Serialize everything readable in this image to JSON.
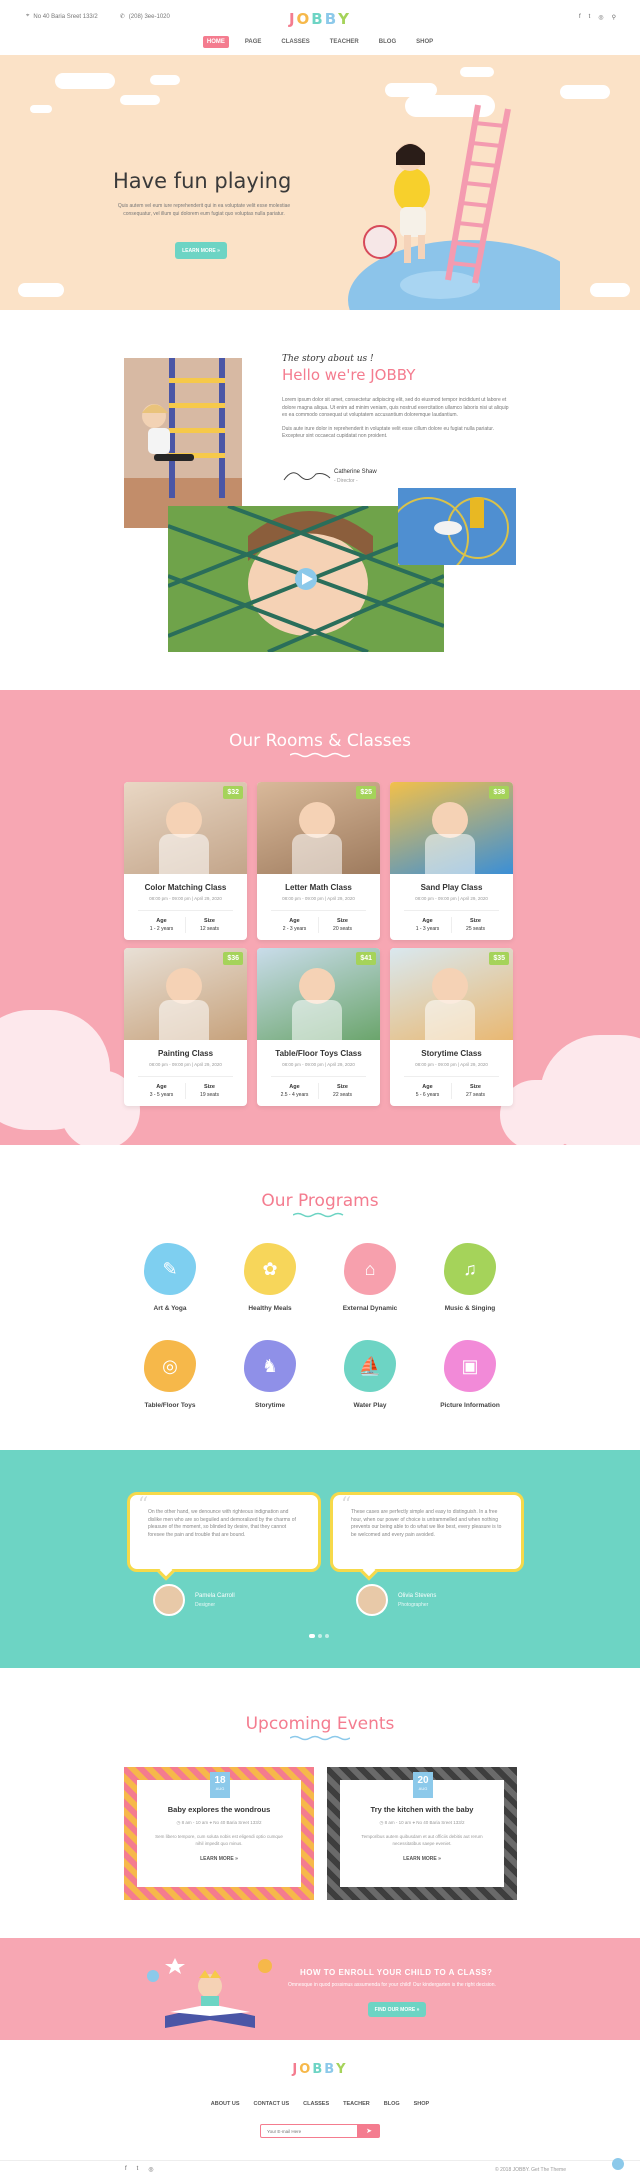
{
  "topbar": {
    "address": "No 40 Baria Sreet 133/2",
    "phone": "(208) 3ee-1020",
    "social": [
      "f",
      "t",
      "◎",
      "⚲"
    ]
  },
  "logo": {
    "letters": [
      "J",
      "O",
      "B",
      "B",
      "Y"
    ],
    "colors": [
      "#f47c8f",
      "#f6b84a",
      "#6dd4c4",
      "#8cc9ea",
      "#a5d35a"
    ]
  },
  "nav": [
    "HOME",
    "PAGE",
    "CLASSES",
    "TEACHER",
    "BLOG",
    "SHOP"
  ],
  "hero": {
    "title": "Have fun playing",
    "text": "Quis autem vel eum iure reprehenderit qui in ea voluptate velit esse molestiae consequatur, vel illum qui dolorem eum fugiat quo voluptas nulla pariatur.",
    "button": "LEARN MORE »"
  },
  "about": {
    "tagline": "The story about us !",
    "title": "Hello we're JOBBY",
    "para1": "Lorem ipsum dolor sit amet, consectetur adipiscing elit, sed do eiusmod tempor incididunt ut labore et dolore magna aliqua. Ut enim ad minim veniam, quis nostrud exercitation ullamco laboris nisi ut aliquip ex ea commodo consequat ut voluptatem accusantium doloremque laudantium.",
    "para2": "Duis aute irure dolor in reprehenderit in voluptate velit esse cillum dolore eu fugiat nulla pariatur. Excepteur sint occaecat cupidatat non proident.",
    "person_name": "Catherine Shaw",
    "person_role": "- Director -"
  },
  "rooms": {
    "title": "Our Rooms & Classes",
    "age_label": "Age",
    "size_label": "Size",
    "classes": [
      {
        "name": "Color Matching Class",
        "time": "08:00 pm - 09:00 pm",
        "date": "April 29, 2020",
        "price": "$32",
        "age": "1 - 2 years",
        "size": "12 seats",
        "c1": "#e9d7c4",
        "c2": "#c3a58a"
      },
      {
        "name": "Letter Math Class",
        "time": "08:00 pm - 09:00 pm",
        "date": "April 29, 2020",
        "price": "$25",
        "age": "2 - 3 years",
        "size": "20 seats",
        "c1": "#d9b99a",
        "c2": "#9e7b5e"
      },
      {
        "name": "Sand Play Class",
        "time": "08:00 pm - 09:00 pm",
        "date": "April 29, 2020",
        "price": "$38",
        "age": "1 - 3 years",
        "size": "25 seats",
        "c1": "#f2c04a",
        "c2": "#3b8fd6"
      },
      {
        "name": "Painting Class",
        "time": "08:00 pm - 09:00 pm",
        "date": "April 29, 2020",
        "price": "$36",
        "age": "3 - 5 years",
        "size": "19 seats",
        "c1": "#e8e0d6",
        "c2": "#c7a27c"
      },
      {
        "name": "Table/Floor Toys Class",
        "time": "08:00 pm - 09:00 pm",
        "date": "April 29, 2020",
        "price": "$41",
        "age": "2.5 - 4 years",
        "size": "22 seats",
        "c1": "#c9dcea",
        "c2": "#6ba56c"
      },
      {
        "name": "Storytime Class",
        "time": "08:00 pm - 09:00 pm",
        "date": "April 29, 2020",
        "price": "$35",
        "age": "5 - 6 years",
        "size": "27 seats",
        "c1": "#d9e8ef",
        "c2": "#e9b872"
      }
    ]
  },
  "programs": {
    "title": "Our Programs",
    "items": [
      {
        "label": "Art & Yoga",
        "color": "#7ecff0",
        "icon": "palette-icon",
        "glyph": "✎"
      },
      {
        "label": "Healthy Meals",
        "color": "#f7d65a",
        "icon": "food-icon",
        "glyph": "✿"
      },
      {
        "label": "External Dynamic",
        "color": "#f7a0ad",
        "icon": "tent-icon",
        "glyph": "⌂"
      },
      {
        "label": "Music & Singing",
        "color": "#a5d35a",
        "icon": "music-icon",
        "glyph": "♫"
      },
      {
        "label": "Table/Floor Toys",
        "color": "#f6b84a",
        "icon": "ball-icon",
        "glyph": "◎"
      },
      {
        "label": "Storytime",
        "color": "#8f90e8",
        "icon": "rocking-horse-icon",
        "glyph": "♞"
      },
      {
        "label": "Water Play",
        "color": "#6dd4c4",
        "icon": "boat-icon",
        "glyph": "⛵"
      },
      {
        "label": "Picture Information",
        "color": "#f28ad8",
        "icon": "picture-icon",
        "glyph": "▣"
      }
    ]
  },
  "testimonials": [
    {
      "text": "On the other hand, we denounce with righteous indignation and dislike men who are so beguiled and demoralized by the charms of pleasure of the moment, so blinded by desire, that they cannot foresee the pain and trouble that are bound.",
      "name": "Pamela Carroll",
      "role": "Designer"
    },
    {
      "text": "These cases are perfectly simple and easy to distinguish. In a free hour, when our power of choice is untrammelled and when nothing prevents our being able to do what we like best, every pleasure is to be welcomed and every pain avoided.",
      "name": "Olivia Stevens",
      "role": "Photographer"
    }
  ],
  "events": {
    "title": "Upcoming Events",
    "items": [
      {
        "day": "18",
        "month": "AUG",
        "title": "Baby explores the wondrous",
        "time": "8 am - 10 am",
        "place": "No 40 Baria Sreet 133/2",
        "text": "Sem libero tempore, cum soluta nobis est eligendi optio cumque nihil impedit quo minus.",
        "more": "LEARN MORE »",
        "border": "#f6b84a"
      },
      {
        "day": "20",
        "month": "AUG",
        "title": "Try the kitchen with the baby",
        "time": "8 am - 10 am",
        "place": "No 40 Baria Sreet 133/2",
        "text": "Temporibus autem quibusdam et aut officiis debitis aut rerum necessitatibus saepe eveniet.",
        "more": "LEARN MORE »",
        "border": "#6a6a6a"
      }
    ]
  },
  "enroll": {
    "title": "HOW TO ENROLL YOUR CHILD TO A CLASS?",
    "text": "Omnesque in quod possimus assumenda for your child! Our kindergarten is the right decision.",
    "button": "FIND OUR MORE »"
  },
  "footer": {
    "nav": [
      "ABOUT US",
      "CONTACT US",
      "CLASSES",
      "TEACHER",
      "BLOG",
      "SHOP"
    ],
    "email_placeholder": "Your E-mail Here",
    "social": [
      "f",
      "t",
      "◎"
    ],
    "copyright": "© 2018 JOBBY. Get The Theme"
  }
}
